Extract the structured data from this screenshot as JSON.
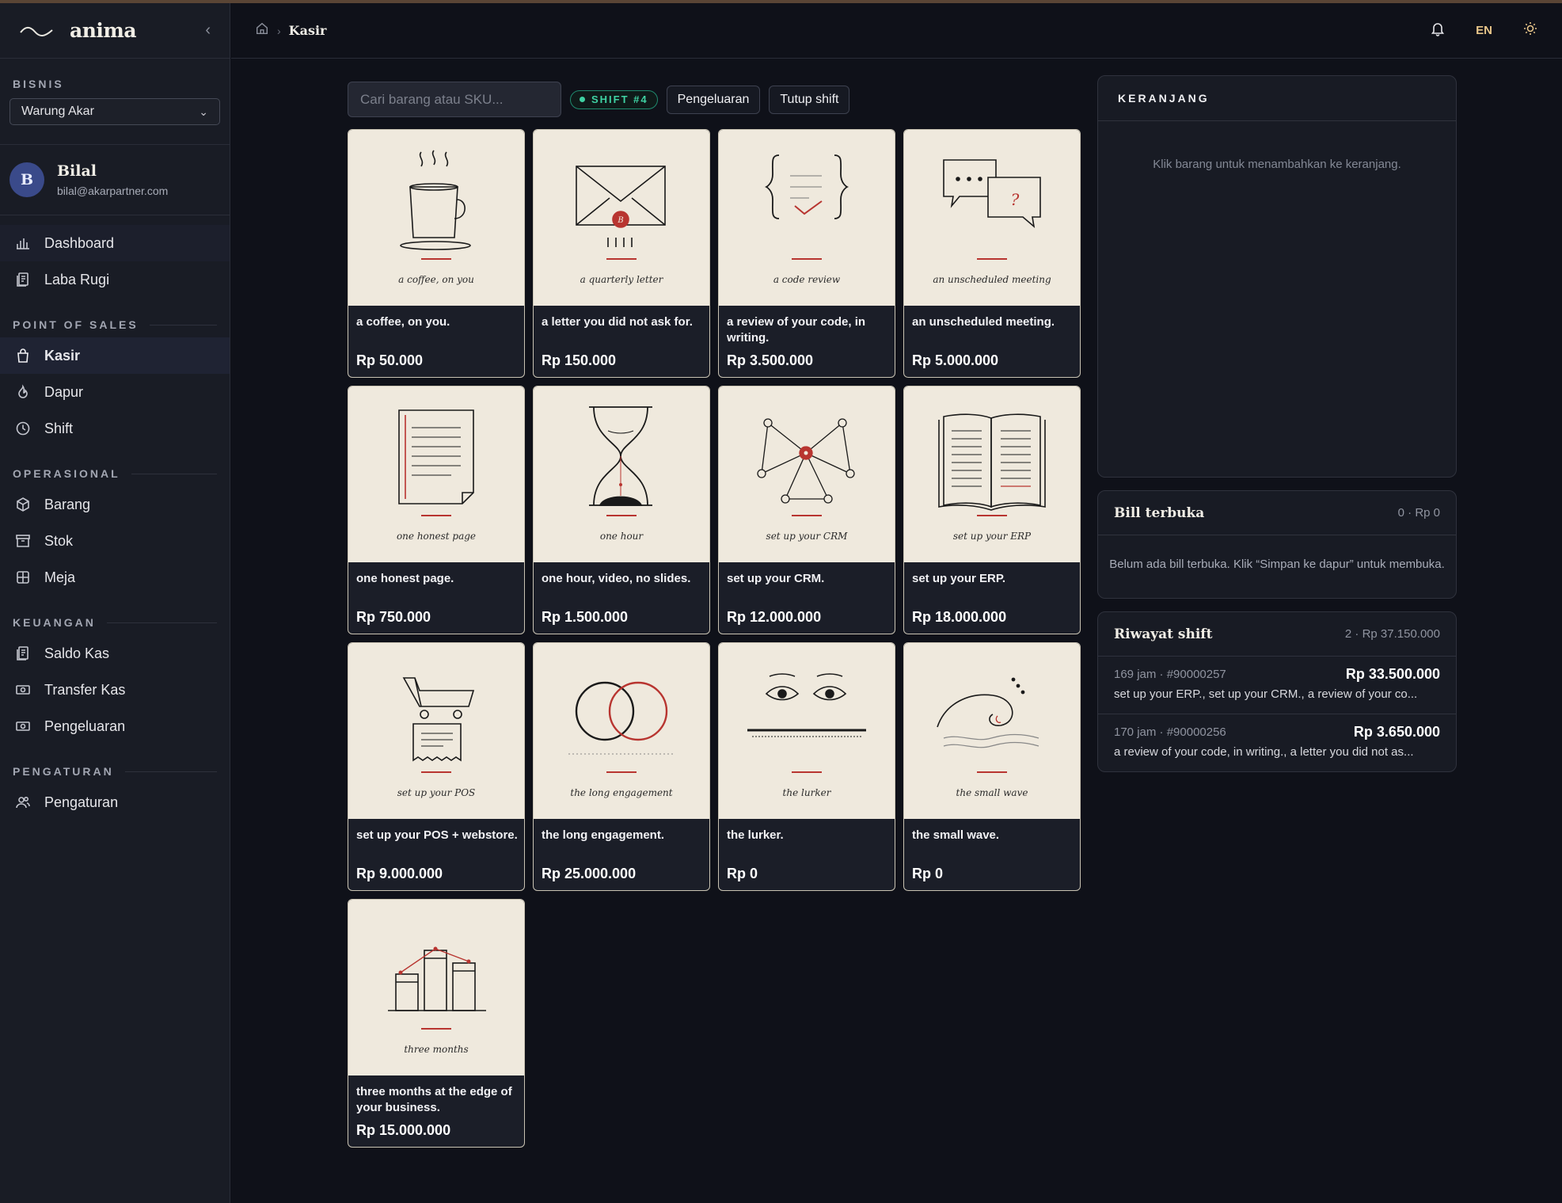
{
  "app": {
    "name": "anima"
  },
  "sidebar": {
    "business_label": "BISNIS",
    "business_selected": "Warung Akar",
    "user": {
      "initial": "B",
      "name": "Bilal",
      "email": "bilal@akarpartner.com"
    },
    "top_items": [
      {
        "label": "Dashboard",
        "icon": "bar-chart-icon"
      },
      {
        "label": "Laba Rugi",
        "icon": "receipt-icon"
      }
    ],
    "sections": [
      {
        "label": "POINT OF SALES",
        "items": [
          {
            "label": "Kasir",
            "icon": "shopping-bag-icon"
          },
          {
            "label": "Dapur",
            "icon": "fire-icon"
          },
          {
            "label": "Shift",
            "icon": "clock-icon"
          }
        ]
      },
      {
        "label": "OPERASIONAL",
        "items": [
          {
            "label": "Barang",
            "icon": "box-icon"
          },
          {
            "label": "Stok",
            "icon": "archive-icon"
          },
          {
            "label": "Meja",
            "icon": "grid-icon"
          }
        ]
      },
      {
        "label": "KEUANGAN",
        "items": [
          {
            "label": "Saldo Kas",
            "icon": "receipt-icon"
          },
          {
            "label": "Transfer Kas",
            "icon": "banknote-icon"
          },
          {
            "label": "Pengeluaran",
            "icon": "banknote-icon"
          }
        ]
      },
      {
        "label": "PENGATURAN",
        "items": [
          {
            "label": "Pengaturan",
            "icon": "users-icon"
          }
        ]
      }
    ]
  },
  "topbar": {
    "breadcrumb_current": "Kasir",
    "language": "EN"
  },
  "toolbar": {
    "search_placeholder": "Cari barang atau SKU...",
    "shift_badge": "SHIFT #4",
    "expense_button": "Pengeluaran",
    "close_shift_button": "Tutup shift"
  },
  "products": [
    {
      "caption": "a coffee, on you",
      "title": "a coffee, on you.",
      "price": "Rp 50.000",
      "art": "coffee-cup-icon"
    },
    {
      "caption": "a quarterly letter",
      "title": "a letter you did not ask for.",
      "price": "Rp 150.000",
      "art": "envelope-icon"
    },
    {
      "caption": "a code review",
      "title": "a review of your code, in writing.",
      "price": "Rp 3.500.000",
      "art": "code-braces-icon"
    },
    {
      "caption": "an unscheduled meeting",
      "title": "an unscheduled meeting.",
      "price": "Rp 5.000.000",
      "art": "chat-bubbles-icon"
    },
    {
      "caption": "one honest page",
      "title": "one honest page.",
      "price": "Rp 750.000",
      "art": "page-icon"
    },
    {
      "caption": "one hour",
      "title": "one hour, video, no slides.",
      "price": "Rp 1.500.000",
      "art": "hourglass-icon"
    },
    {
      "caption": "set up your CRM",
      "title": "set up your CRM.",
      "price": "Rp 12.000.000",
      "art": "network-icon"
    },
    {
      "caption": "set up your ERP",
      "title": "set up your ERP.",
      "price": "Rp 18.000.000",
      "art": "open-book-icon"
    },
    {
      "caption": "set up your POS",
      "title": "set up your POS + webstore.",
      "price": "Rp 9.000.000",
      "art": "cart-receipt-icon"
    },
    {
      "caption": "the long engagement",
      "title": "the long engagement.",
      "price": "Rp 25.000.000",
      "art": "rings-icon"
    },
    {
      "caption": "the lurker",
      "title": "the lurker.",
      "price": "Rp 0",
      "art": "eyes-icon"
    },
    {
      "caption": "the small wave",
      "title": "the small wave.",
      "price": "Rp 0",
      "art": "wave-icon"
    },
    {
      "caption": "three months",
      "title": "three months at the edge of your business.",
      "price": "Rp 15.000.000",
      "art": "bar-growth-icon"
    }
  ],
  "cart": {
    "title": "KERANJANG",
    "empty_text": "Klik barang untuk menambahkan ke keranjang."
  },
  "open_bills": {
    "title": "Bill terbuka",
    "meta": "0 · Rp 0",
    "empty_text": "Belum ada bill terbuka. Klik “Simpan ke dapur” untuk membuka."
  },
  "shift_history": {
    "title": "Riwayat shift",
    "meta": "2 · Rp 37.150.000",
    "rows": [
      {
        "meta": "169 jam · #90000257",
        "amount": "Rp 33.500.000",
        "items": "set up your ERP., set up your CRM., a review of your co..."
      },
      {
        "meta": "170 jam · #90000256",
        "amount": "Rp 3.650.000",
        "items": "a review of your code, in writing., a letter you did not as..."
      }
    ]
  }
}
